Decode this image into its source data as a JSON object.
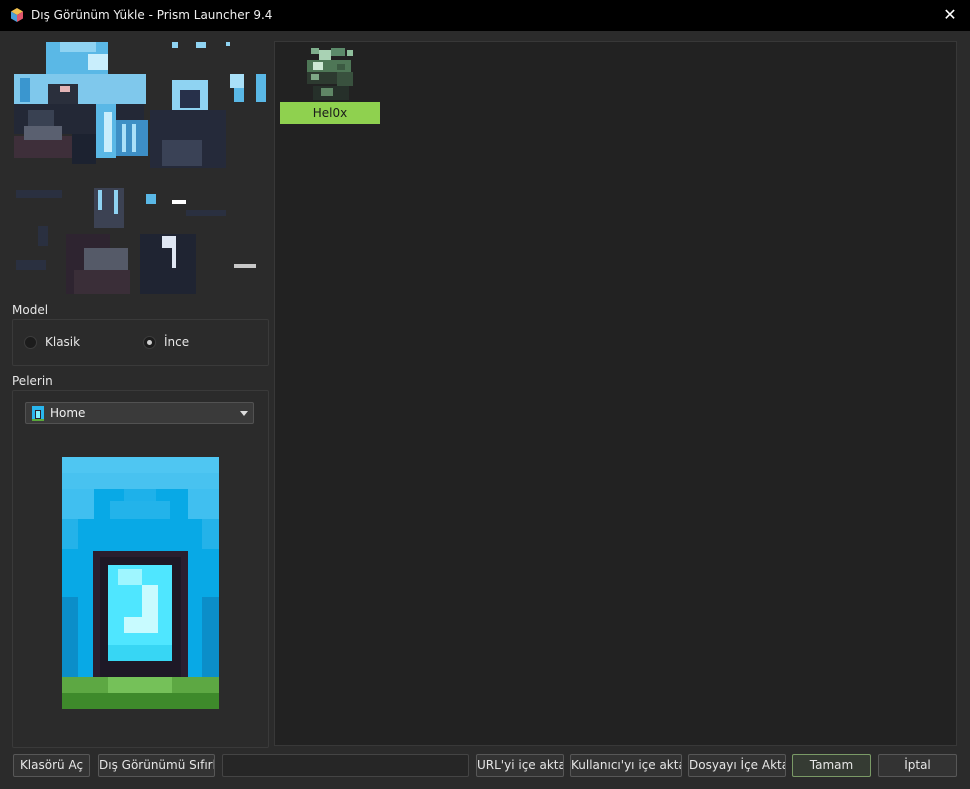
{
  "window": {
    "title": "Dış Görünüm Yükle - Prism Launcher 9.4"
  },
  "model": {
    "label": "Model",
    "options": [
      {
        "label": "Klasik",
        "selected": false
      },
      {
        "label": "İnce",
        "selected": true
      }
    ]
  },
  "cape": {
    "label": "Pelerin",
    "selected": "Home"
  },
  "skins": [
    {
      "name": "Hel0x",
      "selected": true
    }
  ],
  "buttons": {
    "open_folder": "Klasörü Aç",
    "reset_skin": "Dış Görünümü Sıfırla",
    "import_url": "URL'yi içe aktar",
    "import_user": "Kullanıcı'yı içe aktar",
    "import_file": "Dosyayı İçe Aktar",
    "ok": "Tamam",
    "cancel": "İptal"
  },
  "name_field": {
    "value": "",
    "placeholder": ""
  },
  "colors": {
    "titlebar": "#000000",
    "window_bg": "#2b2b2b",
    "list_bg": "#222222",
    "selection": "#8fd14f",
    "default_button_border": "#7a9a66"
  },
  "icons": {
    "app": "prism-launcher-icon",
    "close": "close-icon",
    "cape": "cape-icon",
    "dropdown": "chevron-down-icon"
  }
}
